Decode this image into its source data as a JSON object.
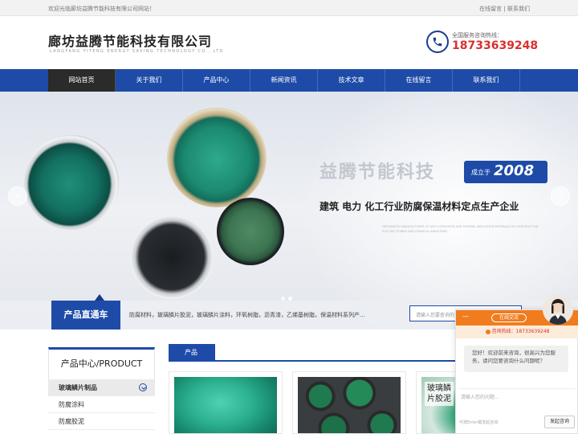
{
  "topbar": {
    "welcome": "欢迎光临廊坊益腾节能科技有限公司网站！",
    "links": [
      "在线留言",
      "联系我们"
    ],
    "separator": "|"
  },
  "header": {
    "company_cn": "廊坊益腾节能科技有限公司",
    "company_en": "LANGFANG YITENG ENERGY SAVING TECHNOLOGY CO., LTD",
    "hotline_label": "全国服务咨询热线：",
    "hotline_number": "18733639248",
    "phone_icon": "phone-icon"
  },
  "nav": {
    "items": [
      "网站首页",
      "关于我们",
      "产品中心",
      "新闻资讯",
      "技术文章",
      "在线留言",
      "联系我们"
    ],
    "active_index": 0
  },
  "banner": {
    "title": "益腾节能科技",
    "since_label": "成立于",
    "since_year": "2008",
    "slogan": "建筑 电力 化工行业防腐保温材料定点生产企业",
    "fine_print": "DESIGNATED MANUFACTURER OF ANTI-CORROSION AND THERMAL INSULATION MATERIALS IN CONSTRUCTION, ELECTRIC POWER AND CHEMICAL INDUSTRIES",
    "prev_arrow": "‹",
    "next_arrow": "›",
    "slide_count": 2,
    "active_slide": 1
  },
  "strip": {
    "label": "产品直通车",
    "keywords": "防腐材料，玻璃鳞片胶泥，玻璃鳞片涂料，环氧树脂，沥青漆，乙烯基树脂，保温材料系列产...",
    "search_placeholder": "请输入您要查询的"
  },
  "sidebar": {
    "title": "产品中心/PRODUCT",
    "items": [
      {
        "label": "玻璃鳞片制品",
        "category": true
      },
      {
        "label": "防腐涂料",
        "category": false
      },
      {
        "label": "防腐胶泥",
        "category": false
      }
    ]
  },
  "products": {
    "tab": "产品",
    "third_overlay": "玻璃鳞\n片胶泥"
  },
  "chat": {
    "minimize": "—",
    "status": "在线交流",
    "hotline": "咨询热线：18733639248",
    "message": "您好！欢迎前来咨询，很高兴为您服务，请问您要咨询什么问题呢？",
    "input_placeholder": "请输入您的问题...",
    "enter_hint": "可按Enter键发起咨询",
    "send_label": "发起咨询"
  },
  "colors": {
    "brand_blue": "#1e4ba8",
    "hotline_red": "#d9302c",
    "chat_orange": "#f07c1e"
  }
}
